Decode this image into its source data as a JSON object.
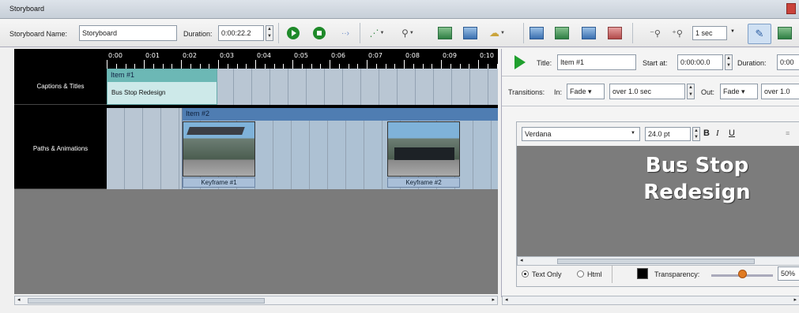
{
  "window": {
    "title": "Storyboard"
  },
  "toolbar": {
    "storyboard_name_label": "Storyboard Name:",
    "storyboard_name_value": "Storyboard",
    "duration_label": "Duration:",
    "duration_value": "0:00:22.2",
    "interval_value": "1 sec"
  },
  "timeline": {
    "ticks": [
      "0:00",
      "0:01",
      "0:02",
      "0:03",
      "0:04",
      "0:05",
      "0:06",
      "0:07",
      "0:08",
      "0:09",
      "0:10"
    ],
    "rows": [
      {
        "label": "Captions & Titles"
      },
      {
        "label": "Paths & Animations"
      }
    ],
    "item1": {
      "title": "Item #1",
      "text": "Bus Stop Redesign"
    },
    "item2": {
      "title": "Item #2"
    },
    "keyframes": [
      {
        "label": "Keyframe #1"
      },
      {
        "label": "Keyframe #2"
      }
    ]
  },
  "properties": {
    "title_label": "Title:",
    "title_value": "Item #1",
    "start_label": "Start at:",
    "start_value": "0:00:00.0",
    "duration_label": "Duration:",
    "duration_value": "0:00",
    "transitions_label": "Transitions:",
    "in_label": "In:",
    "in_value": "Fade",
    "in_over": "over 1.0 sec",
    "out_label": "Out:",
    "out_value": "Fade",
    "out_over": "over 1.0"
  },
  "editor": {
    "font_family": "Verdana",
    "font_size": "24.0 pt",
    "bold": "B",
    "italic": "I",
    "underline": "U",
    "preview_line1": "Bus Stop",
    "preview_line2": "Redesign",
    "mode_text_only": "Text Only",
    "mode_html": "Html",
    "transparency_label": "Transparency:",
    "transparency_value": "50%",
    "transparency_level": 0.5,
    "text_color": "#000000"
  }
}
